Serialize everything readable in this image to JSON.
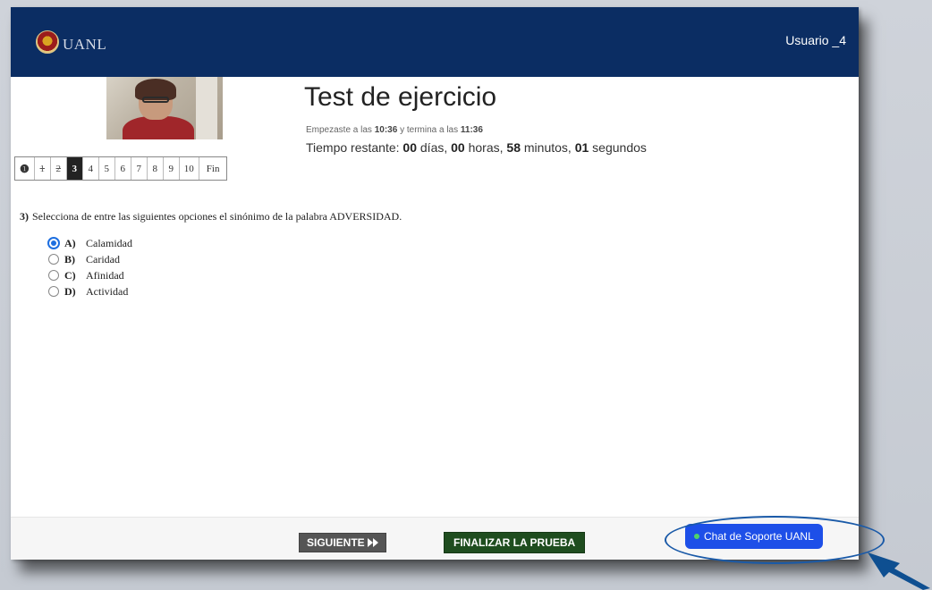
{
  "header": {
    "logo_text": "UANL",
    "username": "Usuario _4"
  },
  "test": {
    "title": "Test de ejercicio",
    "started_prefix": "Empezaste a las",
    "start_time": "10:36",
    "started_middle": "y termina a las",
    "end_time": "11:36",
    "remaining_label": "Tiempo restante:",
    "days": "00",
    "days_label": "días,",
    "hours": "00",
    "hours_label": "horas,",
    "minutes": "58",
    "minutes_label": "minutos,",
    "seconds": "01",
    "seconds_label": "segundos"
  },
  "navigation": {
    "info_label": "❶",
    "items": [
      {
        "label": "1",
        "state": "done"
      },
      {
        "label": "2",
        "state": "done"
      },
      {
        "label": "3",
        "state": "current"
      },
      {
        "label": "4",
        "state": "pending"
      },
      {
        "label": "5",
        "state": "pending"
      },
      {
        "label": "6",
        "state": "pending"
      },
      {
        "label": "7",
        "state": "pending"
      },
      {
        "label": "8",
        "state": "pending"
      },
      {
        "label": "9",
        "state": "pending"
      },
      {
        "label": "10",
        "state": "pending"
      }
    ],
    "fin_label": "Fin"
  },
  "question": {
    "number": "3)",
    "text": "Selecciona de entre las siguientes opciones el sinónimo de la palabra ADVERSIDAD.",
    "options": [
      {
        "letter": "A)",
        "text": "Calamidad",
        "selected": true
      },
      {
        "letter": "B)",
        "text": "Caridad",
        "selected": false
      },
      {
        "letter": "C)",
        "text": "Afinidad",
        "selected": false
      },
      {
        "letter": "D)",
        "text": "Actividad",
        "selected": false
      }
    ]
  },
  "footer": {
    "next_label": "SIGUIENTE",
    "next_icon": "fast-forward-icon",
    "finish_label": "FINALIZAR LA PRUEBA",
    "chat_label": "Chat de Soporte UANL"
  },
  "colors": {
    "header_bg": "#0b2d63",
    "finish_bg": "#1f4d1f",
    "chat_bg": "#1d4fe8",
    "radio_accent": "#1e6fe0"
  }
}
